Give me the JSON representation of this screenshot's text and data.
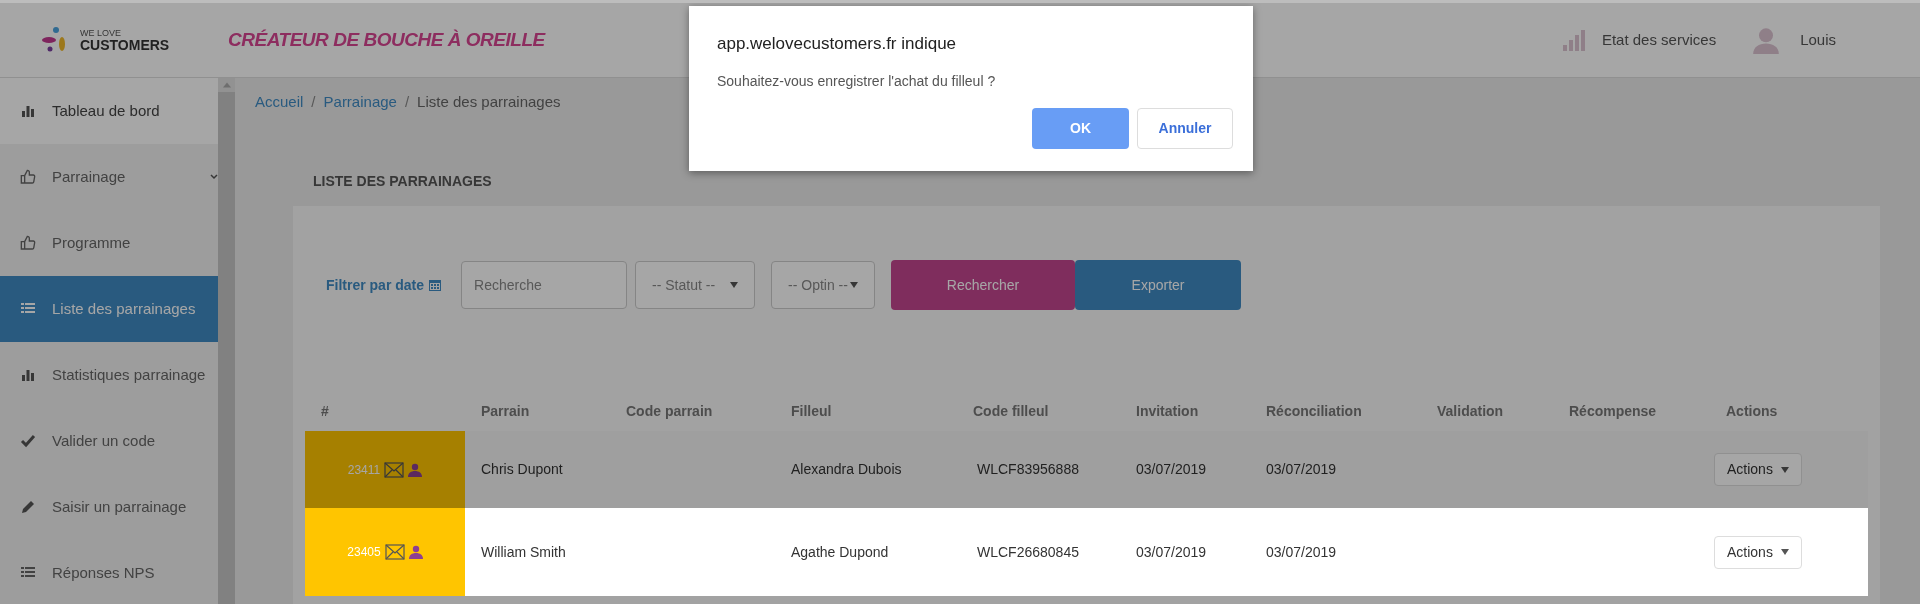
{
  "header": {
    "logo_small": "WE LOVE",
    "logo_big": "CUSTOMERS",
    "tagline": "CRÉATEUR DE BOUCHE À OREILLE",
    "status_link": "Etat des services",
    "user": "Louis"
  },
  "sidebar": {
    "items": [
      {
        "label": "Tableau de bord",
        "selected": false,
        "kind": "top"
      },
      {
        "label": "Parrainage",
        "selected": false,
        "kind": "group"
      },
      {
        "label": "Programme",
        "selected": false,
        "kind": "sub"
      },
      {
        "label": "Liste des parrainages",
        "selected": true,
        "kind": "sub"
      },
      {
        "label": "Statistiques parrainage",
        "selected": false,
        "kind": "sub"
      },
      {
        "label": "Valider un code",
        "selected": false,
        "kind": "sub"
      },
      {
        "label": "Saisir un parrainage",
        "selected": false,
        "kind": "sub"
      },
      {
        "label": "Réponses NPS",
        "selected": false,
        "kind": "sub"
      }
    ]
  },
  "breadcrumb": [
    {
      "label": "Accueil",
      "kind": "link"
    },
    {
      "label": "Parrainage",
      "kind": "link",
      "separator": "/"
    },
    {
      "label": "Liste des parrainages",
      "kind": "current",
      "separator": "/"
    }
  ],
  "card": {
    "title": "LISTE DES PARRAINAGES",
    "filters": {
      "date_label": "Filtrer par date",
      "search": {
        "placeholder": "Recherche"
      },
      "status": "-- Statut --",
      "optin": "-- Optin --",
      "search_button": "Rechercher",
      "export_button": "Exporter"
    },
    "table": {
      "columns": [
        "#",
        "Parrain",
        "Code parrain",
        "Filleul",
        "Code filleul",
        "Invitation",
        "Réconciliation",
        "Validation",
        "Récompense",
        "Actions"
      ],
      "rows": [
        {
          "id": "23411",
          "parrain": "Chris Dupont",
          "filleul": "Alexandra Dubois",
          "code_filleul": "WLCF83956888",
          "invitation": "03/07/2019",
          "reconciliation": "03/07/2019",
          "action": "Actions",
          "highlighted": false
        },
        {
          "id": "23405",
          "parrain": "William Smith",
          "filleul": "Agathe Dupond",
          "code_filleul": "WLCF26680845",
          "invitation": "03/07/2019",
          "reconciliation": "03/07/2019",
          "action": "Actions",
          "highlighted": true
        }
      ]
    }
  },
  "dialog": {
    "title": "app.welovecustomers.fr indique",
    "message": "Souhaitez-vous enregistrer l'achat du filleul ?",
    "ok": "OK",
    "cancel": "Annuler"
  }
}
